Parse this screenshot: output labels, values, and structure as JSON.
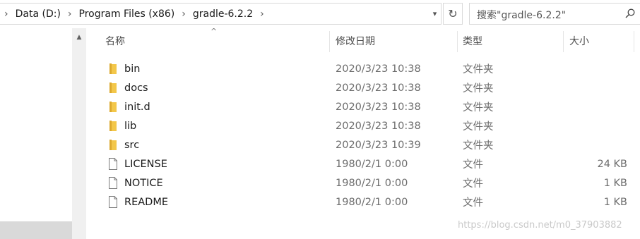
{
  "address_bar": {
    "crumbs": [
      "Data (D:)",
      "Program Files (x86)",
      "gradle-6.2.2"
    ],
    "separator": "›"
  },
  "search": {
    "placeholder": "搜索\"gradle-6.2.2\""
  },
  "columns": {
    "name": "名称",
    "modified": "修改日期",
    "type": "类型",
    "size": "大小"
  },
  "files": [
    {
      "name": "bin",
      "modified": "2020/3/23 10:38",
      "type": "文件夹",
      "size": "",
      "icon": "folder-icon"
    },
    {
      "name": "docs",
      "modified": "2020/3/23 10:38",
      "type": "文件夹",
      "size": "",
      "icon": "folder-icon"
    },
    {
      "name": "init.d",
      "modified": "2020/3/23 10:38",
      "type": "文件夹",
      "size": "",
      "icon": "folder-icon"
    },
    {
      "name": "lib",
      "modified": "2020/3/23 10:38",
      "type": "文件夹",
      "size": "",
      "icon": "folder-icon"
    },
    {
      "name": "src",
      "modified": "2020/3/23 10:39",
      "type": "文件夹",
      "size": "",
      "icon": "folder-icon"
    },
    {
      "name": "LICENSE",
      "modified": "1980/2/1 0:00",
      "type": "文件",
      "size": "24 KB",
      "icon": "file-icon"
    },
    {
      "name": "NOTICE",
      "modified": "1980/2/1 0:00",
      "type": "文件",
      "size": "1 KB",
      "icon": "file-icon"
    },
    {
      "name": "README",
      "modified": "1980/2/1 0:00",
      "type": "文件",
      "size": "1 KB",
      "icon": "file-icon"
    }
  ],
  "watermark": "https://blog.csdn.net/m0_37903882",
  "colors": {
    "folder": "#f3c74a",
    "folder_dark": "#dca92e",
    "border": "#d9d9d9",
    "header_text": "#4d4d4d"
  }
}
